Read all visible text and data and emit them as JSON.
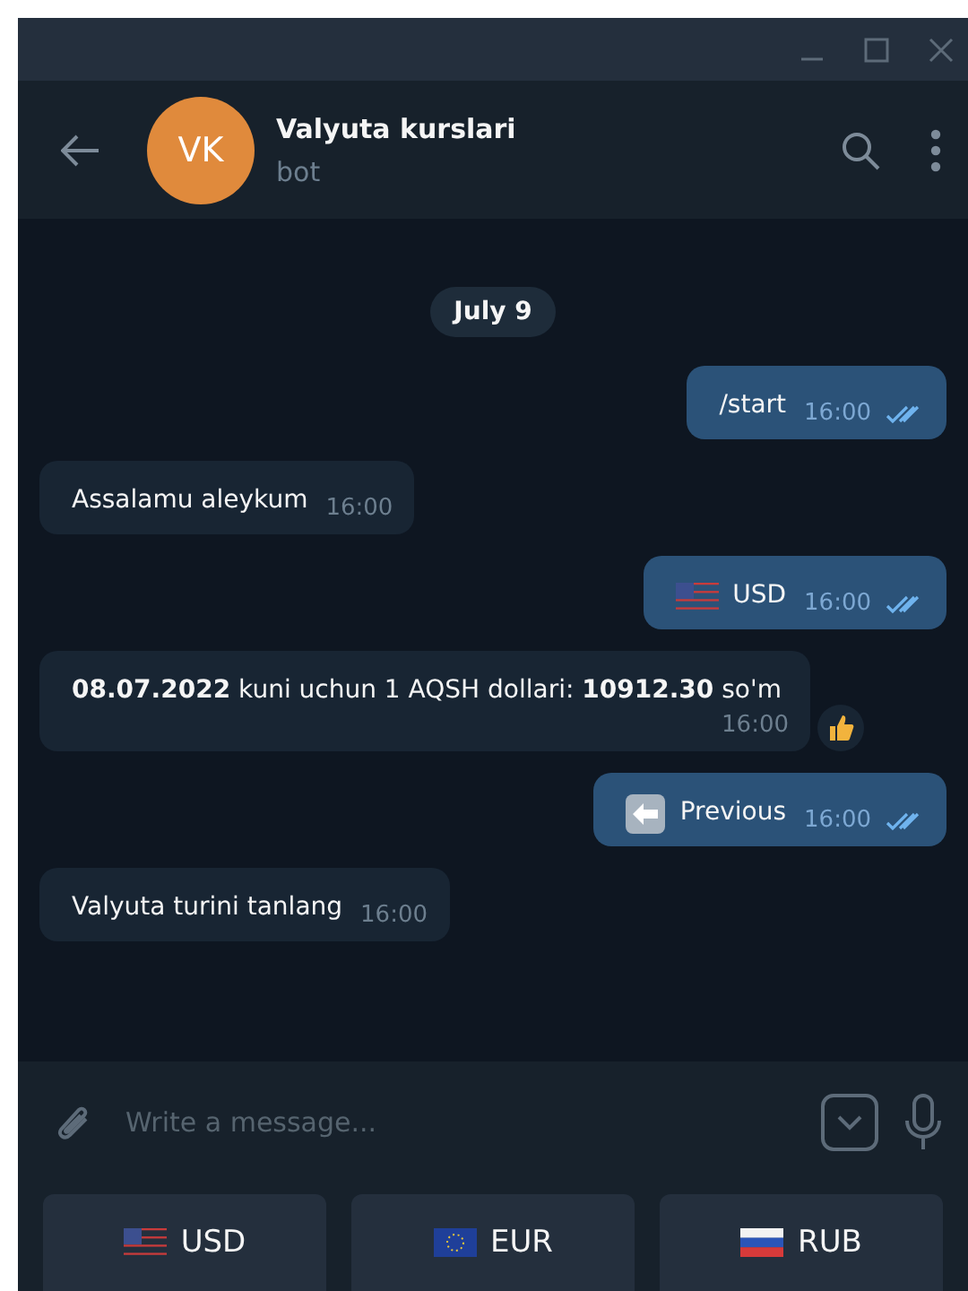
{
  "header": {
    "avatar": "VK",
    "title": "Valyuta kurslari",
    "status": "bot"
  },
  "date": "July 9",
  "messages": [
    {
      "kind": "out",
      "text": "/start",
      "time": "16:00",
      "read": true
    },
    {
      "kind": "in",
      "text": "Assalamu aleykum",
      "time": "16:00"
    },
    {
      "kind": "out",
      "badge": {
        "kind": "us"
      },
      "text": "USD",
      "time": "16:00",
      "read": true
    },
    {
      "kind": "in",
      "text": "**08.07.2022** kuni uchun 1 AQSH dollari: **10912.30** so'm",
      "time": "16:00",
      "reaction": {
        "kind": "thumbs-up"
      }
    },
    {
      "kind": "out",
      "badge": {
        "kind": "back"
      },
      "text": "Previous",
      "time": "16:00",
      "read": true
    },
    {
      "kind": "in",
      "text": "Valyuta turini tanlang",
      "time": "16:00"
    }
  ],
  "composer": {
    "placeholder": "Write a message..."
  },
  "keyboard": [
    {
      "kind": "us",
      "label": "USD"
    },
    {
      "kind": "eu",
      "label": "EUR"
    },
    {
      "kind": "ru",
      "label": "RUB"
    }
  ]
}
